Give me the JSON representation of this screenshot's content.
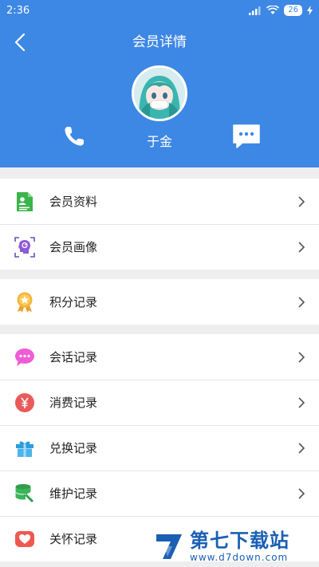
{
  "status_bar": {
    "time": "2:36",
    "battery": "26"
  },
  "header": {
    "title": "会员详情",
    "member_name": "于金"
  },
  "groups": [
    {
      "items": [
        {
          "label": "会员资料",
          "icon": "member-profile-icon"
        },
        {
          "label": "会员画像",
          "icon": "member-portrait-icon"
        }
      ]
    },
    {
      "items": [
        {
          "label": "积分记录",
          "icon": "points-medal-icon"
        }
      ]
    },
    {
      "items": [
        {
          "label": "会话记录",
          "icon": "chat-bubble-icon"
        },
        {
          "label": "消费记录",
          "icon": "yen-coin-icon"
        },
        {
          "label": "兑换记录",
          "icon": "gift-box-icon"
        },
        {
          "label": "维护记录",
          "icon": "database-wrench-icon"
        },
        {
          "label": "关怀记录",
          "icon": "heart-icon"
        }
      ]
    }
  ],
  "watermark": {
    "cn": "第七下载站",
    "en": "www.d7down.com"
  },
  "colors": {
    "header": "#3d87e5",
    "background": "#eeeeee"
  }
}
